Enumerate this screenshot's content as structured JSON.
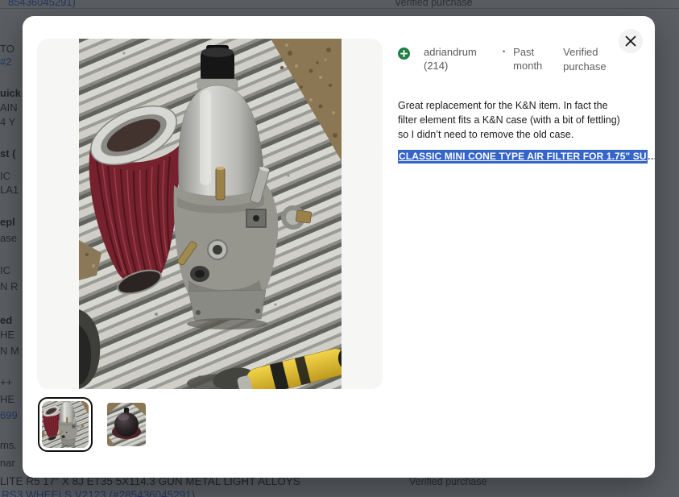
{
  "colors": {
    "overlay": "rgba(30,36,41,0.73)",
    "link_blue": "#3665f3",
    "selection_blue": "#3565c6",
    "positive_green": "#1f8041",
    "modal_bg": "#ffffff",
    "photo_panel_bg": "#f6f6f5"
  },
  "background": {
    "top_left_fragment": "85436045291)",
    "top_right_label": "Verified purchase",
    "left_fragments": [
      "TO",
      "#2",
      "uick",
      "AIN",
      "4 Y",
      "st (",
      "IC",
      "LA1",
      "epl",
      "ase",
      "IC",
      "N R",
      "ed",
      "HE",
      "N M",
      "++",
      "HE",
      "699",
      "ms.",
      "nar"
    ],
    "bottom_line1": "LITE R5 17\" X 8J ET35 5X114.3 GUN METAL LIGHT ALLOYS",
    "bottom_line1_right": "Verified purchase",
    "bottom_line2": "RS3 WHEELS V2123 (#285436045291)"
  },
  "modal": {
    "review": {
      "username": "adriandrum (214)",
      "separator": "•",
      "time_ago": "Past month",
      "badge": "Verified purchase",
      "text_lines": [
        "Great replacement for the K&N item. In fact the",
        "filter element fits a K&N case (with a bit of fettling)",
        "so I didn’t need to remove the old case."
      ],
      "item_link": "CLASSIC MINI CONE TYPE AIR FILTER FOR 1.75\" SU",
      "item_link_ellipsis": "…"
    },
    "gallery": {
      "main_photo_alt": "Carburettor with red cone air filter on aluminium ladder",
      "thumbnails": [
        {
          "alt": "Carburettor with cone filter",
          "selected": true
        },
        {
          "alt": "Dome air filter on ladder",
          "selected": false
        }
      ]
    }
  }
}
